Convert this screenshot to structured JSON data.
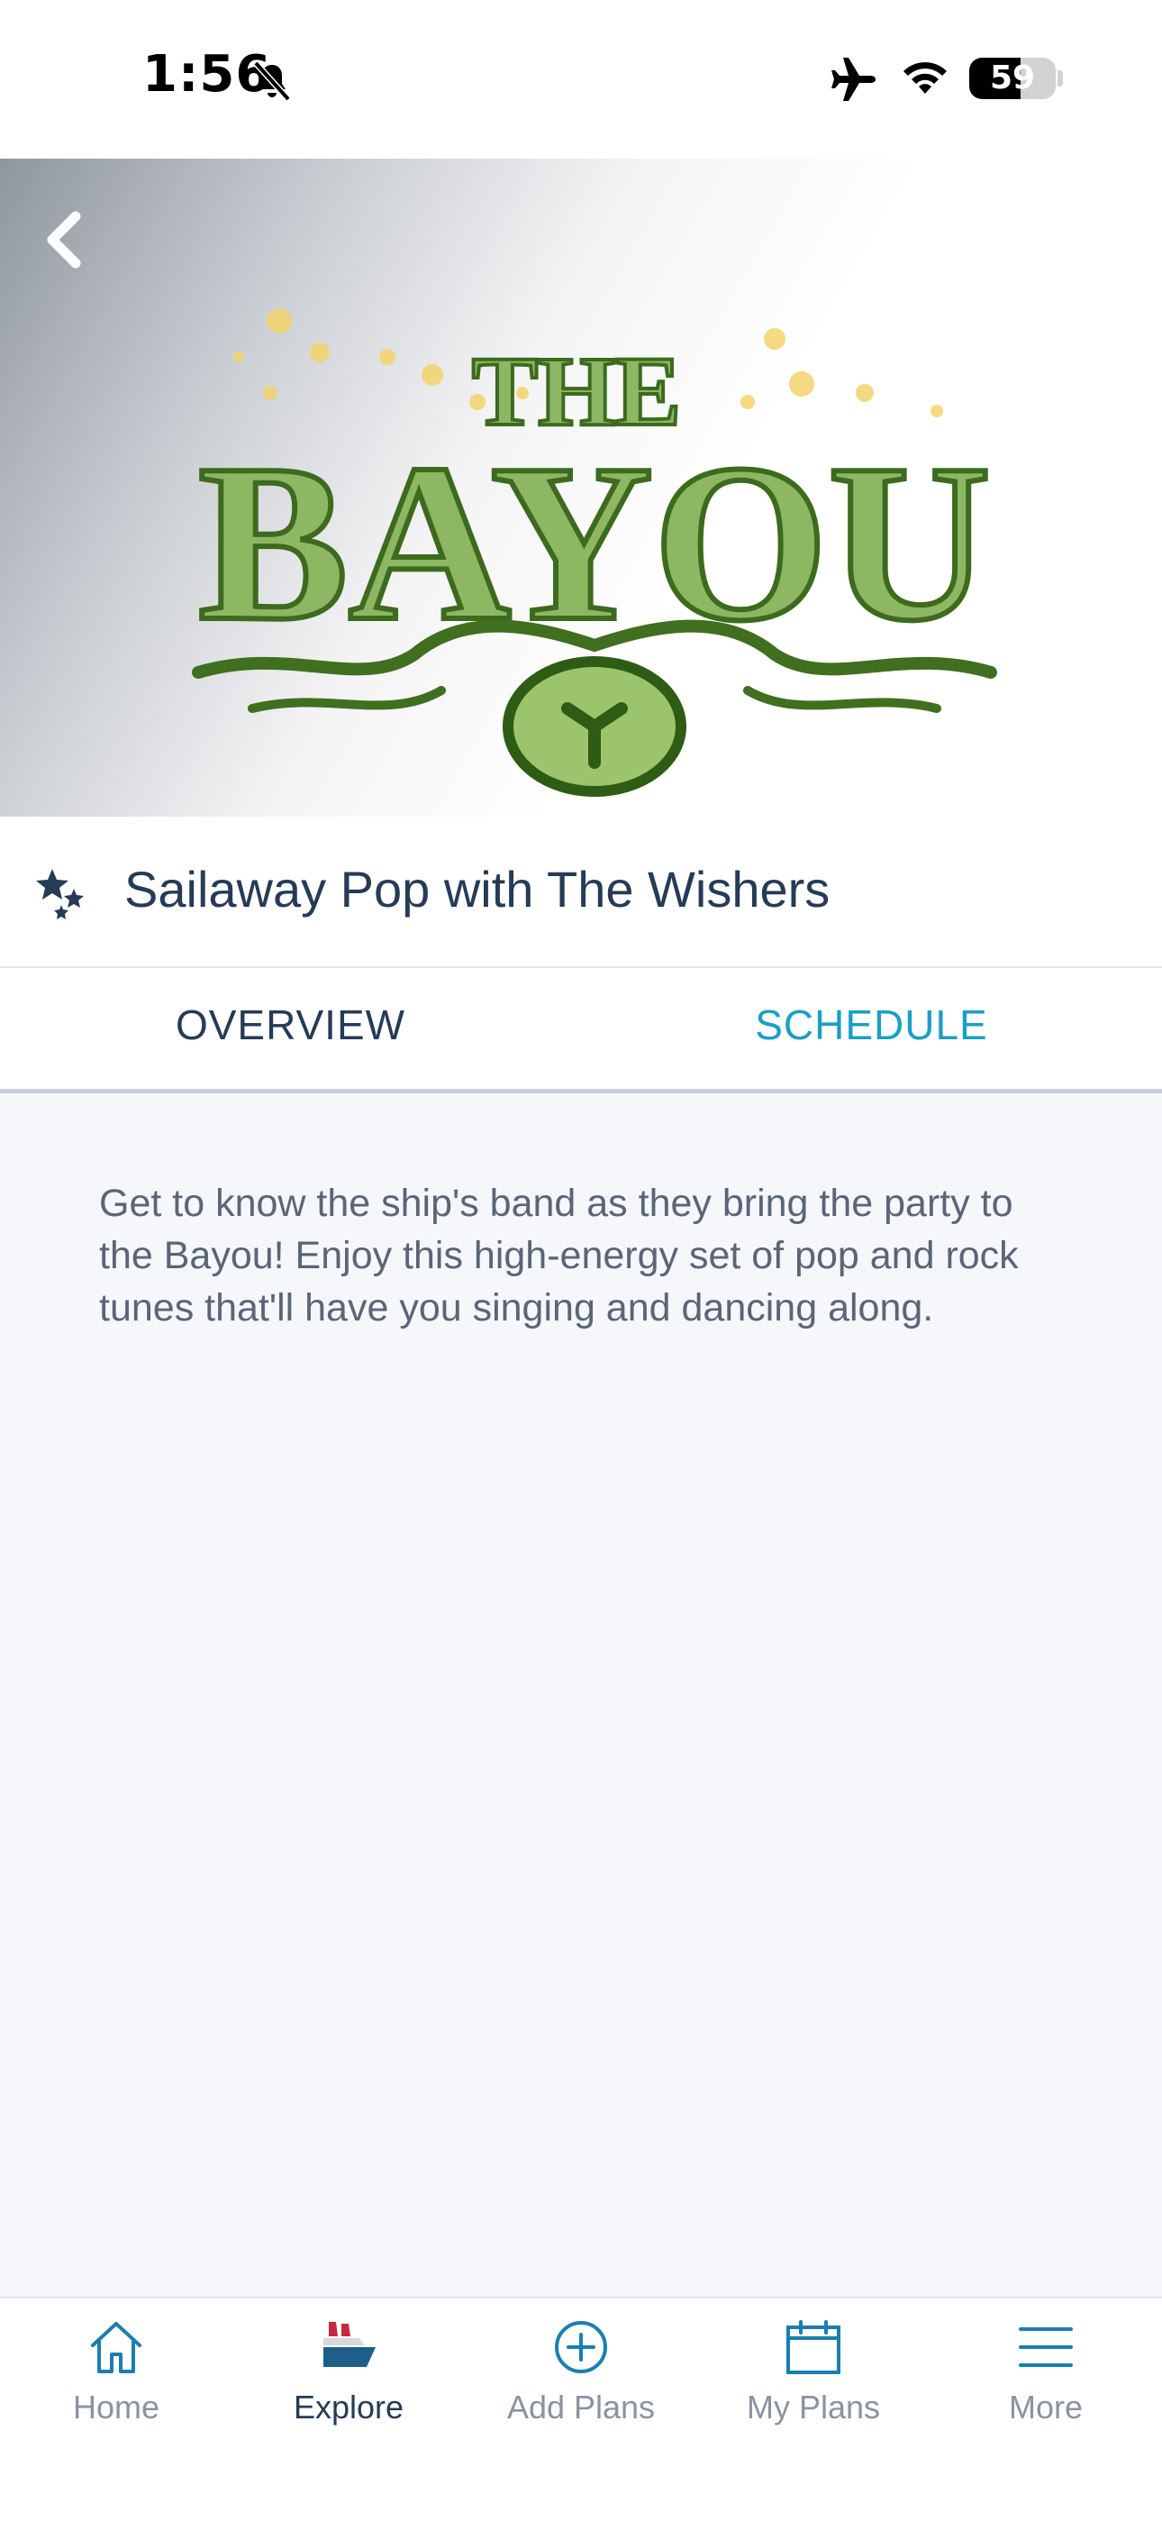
{
  "status_bar": {
    "time": "1:56",
    "battery": "59",
    "battery_level": 0.59
  },
  "hero": {
    "logo_text": "THE BAYOU"
  },
  "activity": {
    "title": "Sailaway Pop with The Wishers",
    "icon": "stars-icon"
  },
  "tabs": [
    {
      "label": "OVERVIEW",
      "selected": false
    },
    {
      "label": "SCHEDULE",
      "selected": true
    }
  ],
  "overview": {
    "description": "Get to know the ship's band as they bring the party to the Bayou! Enjoy this high-energy set of pop and rock tunes that'll have you singing and dancing along."
  },
  "bottom_nav": {
    "items": [
      {
        "label": "Home",
        "icon": "home-icon",
        "active": false
      },
      {
        "label": "Explore",
        "icon": "ship-icon",
        "active": true
      },
      {
        "label": "Add Plans",
        "icon": "add-circle-icon",
        "active": false
      },
      {
        "label": "My Plans",
        "icon": "calendar-icon",
        "active": false
      },
      {
        "label": "More",
        "icon": "menu-icon",
        "active": false
      }
    ]
  },
  "colors": {
    "primary_text": "#253b56",
    "accent": "#1a9fc4",
    "logo_green": "#4f7f2a"
  }
}
